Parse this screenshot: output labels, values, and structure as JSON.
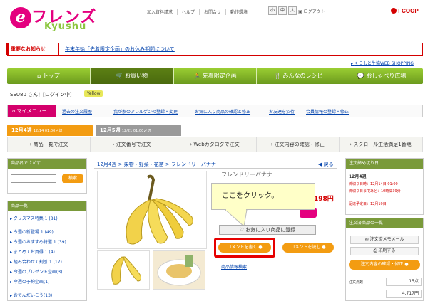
{
  "header": {
    "logo_e": "e",
    "logo_main": "フレンズ",
    "logo_sub": "Kyushu",
    "links": [
      "加入資料請求",
      "ヘルプ",
      "お問合せ",
      "動作環境"
    ],
    "font_sizes": [
      "小",
      "中",
      "大"
    ],
    "logout": "ログアウト",
    "brand": "FCOOP"
  },
  "notice": {
    "label": "重要なお知らせ",
    "text": "年末年始「先着限定企画」のお休み期間について"
  },
  "webshop_link": "くらしと生協WEB SHOPPING",
  "nav": [
    "トップ",
    "お買い物",
    "先着限定企画",
    "みんなのレシピ",
    "おしゃべり広場"
  ],
  "user": {
    "text": "SSU80 さん！[ログイン中]",
    "badge": "Yellow"
  },
  "mymenu": {
    "label": "マイメニュー",
    "links": [
      "過去の注文履歴",
      "我が家のアレルゲンの登録・変更",
      "お気に入り商品の確認と修正",
      "お友達を招待",
      "会員情報の登録・修正"
    ]
  },
  "week_tabs": [
    {
      "week": "12月4週",
      "deadline": "12/14 01:00〆切"
    },
    {
      "week": "12月5週",
      "deadline": "12/21 01:00〆切"
    }
  ],
  "order_bar": [
    "商品一覧で注文",
    "注文番号で注文",
    "Webカタログで注文",
    "注文内容の確認・修正",
    "スクロール生活満足1番地"
  ],
  "left": {
    "search_header": "商品名でさがす",
    "search_button": "検索",
    "list_header": "商品一覧",
    "categories": [
      "クリスマス特集 1 (81)",
      "今週の新登場 1 (49)",
      "今週のおすすめ特選 1 (39)",
      "まとめてお買得 1 (4)",
      "組み合わせて割引 1 (17)",
      "今週のプレゼント企画(3)",
      "今週の予約企画(1)",
      "おでんだいこう(13)"
    ]
  },
  "product": {
    "breadcrumb": "12月4週 > 果物・野菜・花苗 > フレンドリーバナナ",
    "back": "戻る",
    "name": "フレンドリーバナナ",
    "price": "198円",
    "callout": "ここをクリック。",
    "favorite": "お気に入り商品に登録",
    "write_comment": "コメントを書く",
    "read_comment": "コメントを読む",
    "info_link": "商品情報検索"
  },
  "right": {
    "deadline_header": "注文締め切り日",
    "deadline_week": "12月4週",
    "deadline_line1": "締切り日時：12月14日 01:00",
    "deadline_line2": "締切り日まであと：10時間39分",
    "delivery": "配達予定日：12月19日",
    "cart_header": "注文済商品の一覧",
    "memo": "注文済メモメール",
    "print": "印刷する",
    "confirm": "注文内容の確認・修正",
    "count_label": "注文点数",
    "count": "15点",
    "total": "4,717円"
  },
  "colors": {
    "magenta": "#e4007f",
    "green": "#8cc63f",
    "orange": "#f39c12",
    "red": "#e60000"
  }
}
